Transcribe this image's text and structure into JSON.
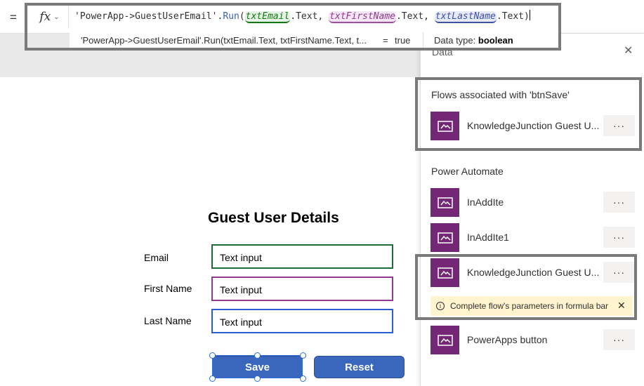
{
  "formula_bar": {
    "equals": "=",
    "fx_label": "fx",
    "formula": {
      "prefix": "'PowerApp->GuestUserEmail'.",
      "fn": "Run",
      "open": "(",
      "arg1": "txtEmail",
      "arg1_suffix": ".Text, ",
      "arg2": "txtFirstName",
      "arg2_suffix": ".Text, ",
      "arg3": "txtLastName",
      "arg3_suffix": ".Text)"
    },
    "result_formula": "'PowerApp->GuestUserEmail'.Run(txtEmail.Text, txtFirstName.Text, t...",
    "result_equals": "=",
    "result_value": "true",
    "data_type_label": "Data type:",
    "data_type_value": "boolean"
  },
  "form": {
    "title": "Guest User Details",
    "email_label": "Email",
    "first_name_label": "First Name",
    "last_name_label": "Last Name",
    "email_value": "Text input",
    "first_name_value": "Text input",
    "last_name_value": "Text input",
    "save_label": "Save",
    "reset_label": "Reset"
  },
  "panel": {
    "title": "Data",
    "associated_title": "Flows associated with 'btnSave'",
    "associated_flows": [
      {
        "name": "KnowledgeJunction Guest U..."
      }
    ],
    "power_automate_title": "Power Automate",
    "flows": [
      {
        "name": "InAddIte"
      },
      {
        "name": "InAddIte1"
      },
      {
        "name": "KnowledgeJunction Guest U..."
      },
      {
        "name": "PowerApps button"
      }
    ],
    "more_label": "···",
    "warning_text": "Complete flow's parameters in formula bar"
  },
  "colors": {
    "flow_icon": "#742774",
    "button": "#3a67bd",
    "warning_bg": "#fff4ce",
    "highlight": "#7a7a7a"
  }
}
